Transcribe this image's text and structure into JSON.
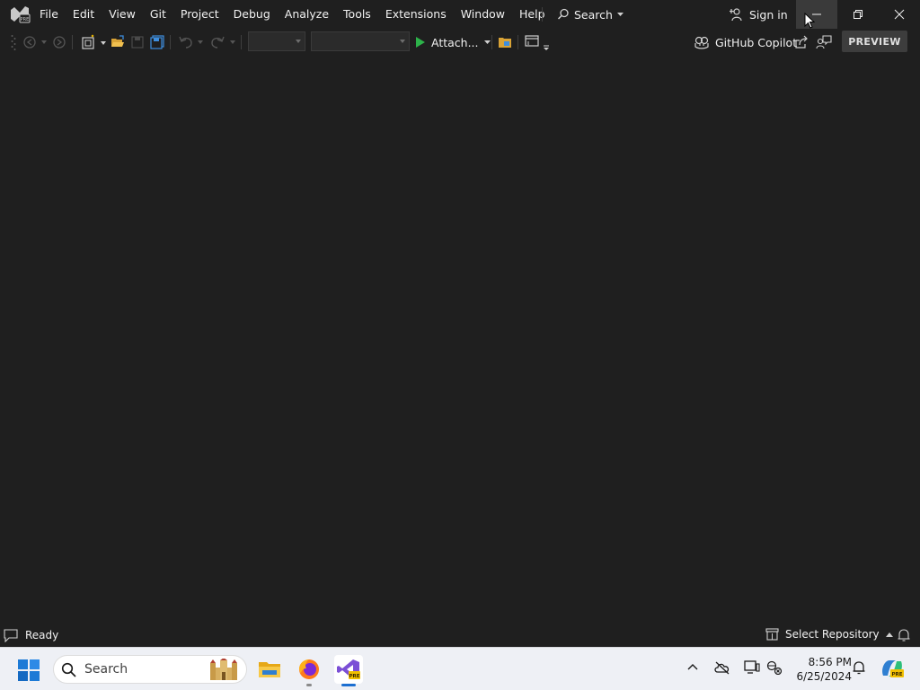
{
  "menu": {
    "items": [
      "File",
      "Edit",
      "View",
      "Git",
      "Project",
      "Debug",
      "Analyze",
      "Tools",
      "Extensions",
      "Window",
      "Help"
    ],
    "search_label": "Search",
    "signin_label": "Sign in",
    "logo_badge": "PRE"
  },
  "toolbar": {
    "attach_label": "Attach...",
    "copilot_label": "GitHub Copilot",
    "preview_label": "PREVIEW"
  },
  "statusbar": {
    "ready": "Ready",
    "repo": "Select Repository"
  },
  "taskbar": {
    "search_placeholder": "Search",
    "time": "8:56 PM",
    "date": "6/25/2024",
    "copilot_badge": "PRE"
  },
  "colors": {
    "background": "#1f1f1f",
    "text": "#f1f1f1",
    "run_green": "#2db34a",
    "vs_purple": "#7b4fd6",
    "taskbar": "#eef0f5"
  }
}
